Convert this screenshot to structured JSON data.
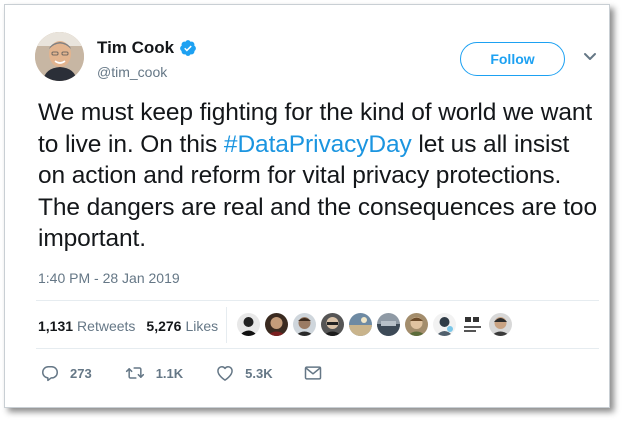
{
  "colors": {
    "accent": "#1da1f2",
    "hashtag": "#1b95e0",
    "text": "#14171a",
    "muted": "#657786",
    "divider": "#e6ecf0"
  },
  "author": {
    "name": "Tim Cook",
    "handle": "@tim_cook",
    "verified_icon": "verified-badge-icon"
  },
  "header": {
    "follow_label": "Follow",
    "menu_icon": "chevron-down-icon"
  },
  "tweet": {
    "text_before": "We must keep fighting for the kind of world we want to live in. On this ",
    "hashtag": "#DataPrivacyDay",
    "text_after": " let us all insist on action and reform for vital privacy protections. The dangers are real and the consequences are too important.",
    "timestamp": "1:40 PM - 28 Jan 2019"
  },
  "stats": {
    "retweets_count": "1,131",
    "retweets_label": "Retweets",
    "likes_count": "5,276",
    "likes_label": "Likes",
    "likers": [
      "liker-1",
      "liker-2",
      "liker-3",
      "liker-4",
      "liker-5",
      "liker-6",
      "liker-7",
      "liker-8",
      "liker-9",
      "liker-10"
    ]
  },
  "actions": {
    "reply_count": "273",
    "retweet_count": "1.1K",
    "like_count": "5.3K",
    "icons": [
      "reply-icon",
      "retweet-icon",
      "like-icon",
      "dm-icon"
    ]
  }
}
